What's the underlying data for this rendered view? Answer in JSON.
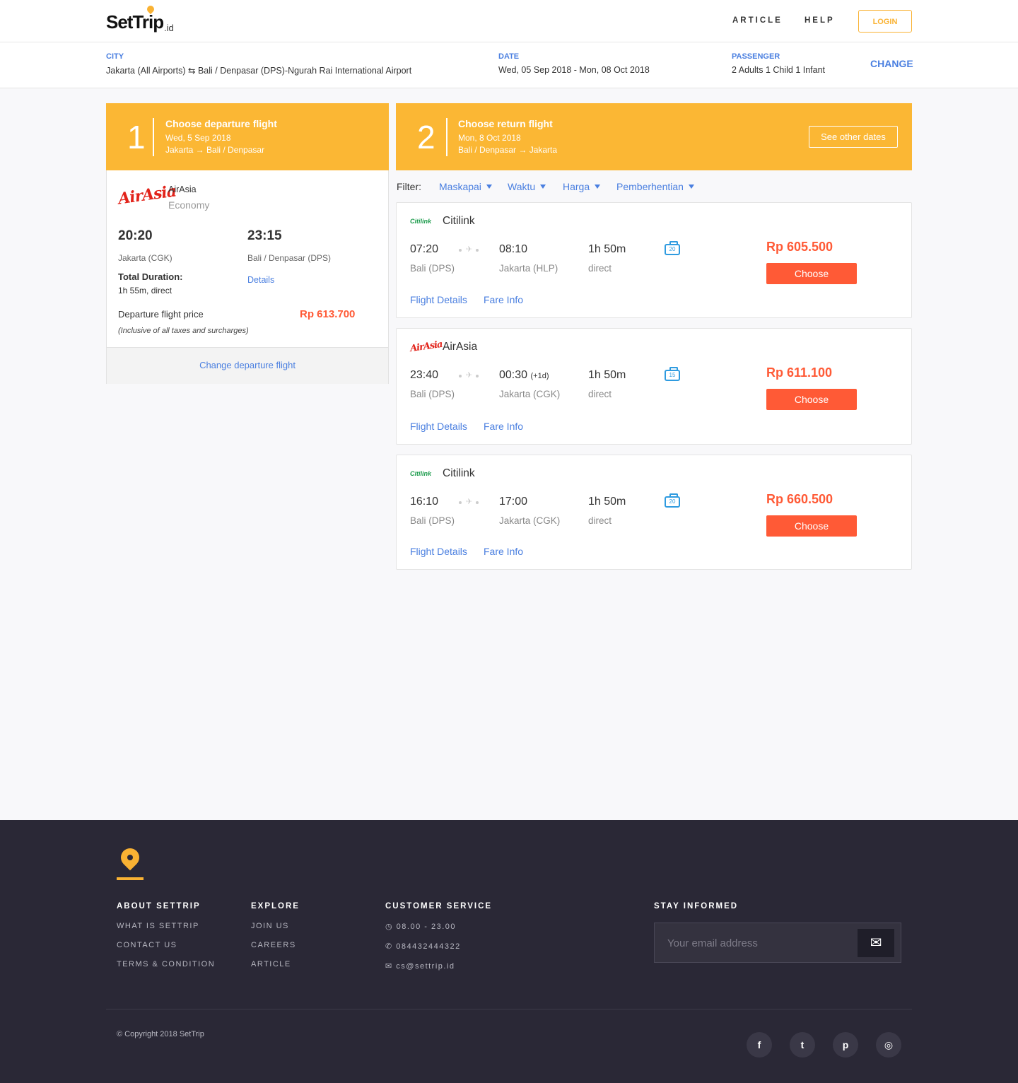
{
  "brand": {
    "name": "SetTrip",
    "tld": ".id"
  },
  "nav": {
    "article": "ARTICLE",
    "help": "HELP",
    "login": "LOGIN"
  },
  "search": {
    "city_label": "CITY",
    "city_value": "Jakarta (All Airports) ⇆ Bali / Denpasar (DPS)-Ngurah Rai International Airport",
    "date_label": "DATE",
    "date_value": "Wed, 05 Sep 2018 - Mon, 08 Oct 2018",
    "passenger_label": "PASSENGER",
    "passenger_value": "2 Adults 1 Child 1 Infant",
    "change": "CHANGE"
  },
  "step1": {
    "num": "1",
    "title": "Choose departure flight",
    "date": "Wed, 5 Sep 2018",
    "route": "Jakarta → Bali / Denpasar"
  },
  "step2": {
    "num": "2",
    "title": "Choose return flight",
    "date": "Mon, 8 Oct 2018",
    "route": "Bali / Denpasar → Jakarta",
    "other_dates": "See other dates"
  },
  "departure": {
    "logo_text": "AirAsia",
    "airline": "AirAsia",
    "class": "Economy",
    "dep_time": "20:20",
    "arr_time": "23:15",
    "dep_place": "Jakarta (CGK)",
    "arr_place": "Bali / Denpasar (DPS)",
    "duration_label": "Total Duration:",
    "duration_value": "1h 55m, direct",
    "details": "Details",
    "price_label": "Departure flight price",
    "price": "Rp 613.700",
    "price_note": "(Inclusive of all taxes and surcharges)",
    "change": "Change departure flight"
  },
  "filter": {
    "label": "Filter:",
    "items": [
      "Maskapai",
      "Waktu",
      "Harga",
      "Pemberhentian"
    ]
  },
  "flights": [
    {
      "logo_text": "Citilink",
      "airline": "Citilink",
      "dep_time": "07:20",
      "dep_place": "Bali (DPS)",
      "arr_time": "08:10",
      "arr_note": "",
      "arr_place": "Jakarta (HLP)",
      "duration": "1h 50m",
      "stops": "direct",
      "baggage": "20",
      "price": "Rp 605.500",
      "choose": "Choose",
      "details": "Flight Details",
      "fare": "Fare Info"
    },
    {
      "logo_text": "AirAsia",
      "airline": "AirAsia",
      "dep_time": "23:40",
      "dep_place": "Bali (DPS)",
      "arr_time": "00:30",
      "arr_note": "(+1d)",
      "arr_place": "Jakarta (CGK)",
      "duration": "1h 50m",
      "stops": "direct",
      "baggage": "15",
      "price": "Rp 611.100",
      "choose": "Choose",
      "details": "Flight Details",
      "fare": "Fare Info"
    },
    {
      "logo_text": "Citilink",
      "airline": "Citilink",
      "dep_time": "16:10",
      "dep_place": "Bali (DPS)",
      "arr_time": "17:00",
      "arr_note": "",
      "arr_place": "Jakarta (CGK)",
      "duration": "1h 50m",
      "stops": "direct",
      "baggage": "20",
      "price": "Rp 660.500",
      "choose": "Choose",
      "details": "Flight Details",
      "fare": "Fare Info"
    }
  ],
  "footer": {
    "about": {
      "title": "ABOUT SETTRIP",
      "links": [
        "WHAT IS SETTRIP",
        "CONTACT US",
        "TERMS & CONDITION"
      ]
    },
    "explore": {
      "title": "EXPLORE",
      "links": [
        "JOIN US",
        "CAREERS",
        "ARTICLE"
      ]
    },
    "service": {
      "title": "CUSTOMER SERVICE",
      "hours": "08.00 - 23.00",
      "phone": "084432444322",
      "email": "cs@settrip.id"
    },
    "newsletter": {
      "title": "STAY INFORMED",
      "placeholder": "Your email address"
    },
    "copyright": "© Copyright 2018 SetTrip",
    "social": [
      "facebook-icon",
      "twitter-icon",
      "pinterest-icon",
      "instagram-icon"
    ]
  },
  "colors": {
    "accent": "#fbb734",
    "link": "#4a7fe0",
    "price": "#ff5a36",
    "footer_bg": "#2a2836"
  }
}
